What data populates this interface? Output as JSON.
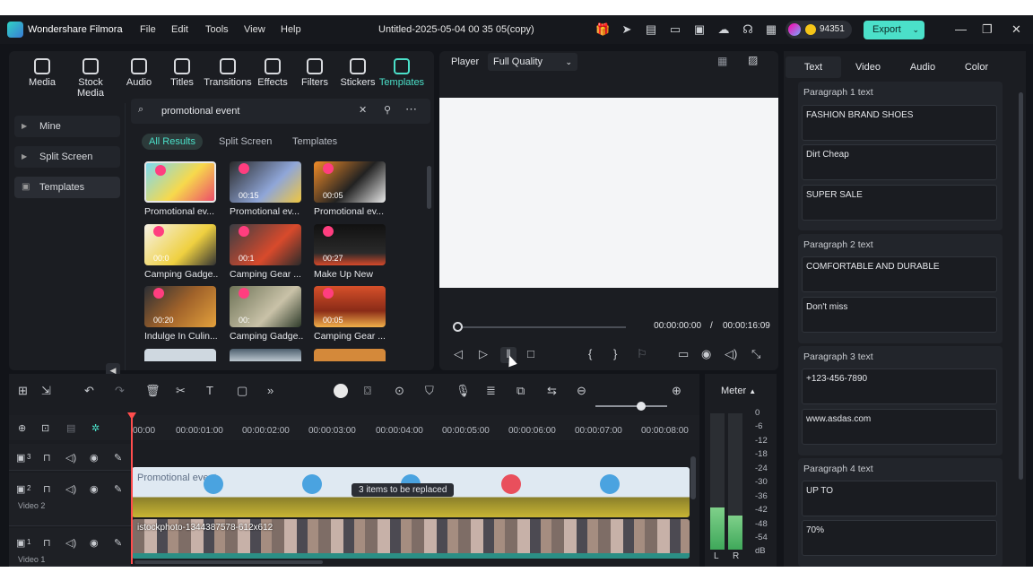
{
  "titlebar": {
    "app_name": "Wondershare Filmora",
    "menus": [
      "File",
      "Edit",
      "Tools",
      "View",
      "Help"
    ],
    "project_title": "Untitled-2025-05-04 00 35 05(copy)",
    "coins": "94351",
    "export_label": "Export"
  },
  "library": {
    "tools": [
      {
        "label": "Media",
        "icon": "media-icon"
      },
      {
        "label": "Stock Media",
        "icon": "stock-media-icon"
      },
      {
        "label": "Audio",
        "icon": "audio-icon"
      },
      {
        "label": "Titles",
        "icon": "titles-icon"
      },
      {
        "label": "Transitions",
        "icon": "transitions-icon"
      },
      {
        "label": "Effects",
        "icon": "effects-icon"
      },
      {
        "label": "Filters",
        "icon": "filters-icon"
      },
      {
        "label": "Stickers",
        "icon": "stickers-icon"
      },
      {
        "label": "Templates",
        "icon": "templates-icon"
      }
    ],
    "active_tool": "Templates",
    "side_items": [
      "Mine",
      "Split Screen",
      "Templates"
    ],
    "search_value": "promotional event",
    "filters": [
      "All Results",
      "Split Screen",
      "Templates"
    ],
    "cards": [
      {
        "title": "Promotional ev...",
        "duration": ""
      },
      {
        "title": "Promotional ev...",
        "duration": "00:15"
      },
      {
        "title": "Promotional ev...",
        "duration": "00:05"
      },
      {
        "title": "Camping Gadge...",
        "duration": "00:0"
      },
      {
        "title": "Camping Gear ...",
        "duration": "00:1"
      },
      {
        "title": "Make Up New",
        "duration": "00:27"
      },
      {
        "title": "Indulge In Culin...",
        "duration": "00:20"
      },
      {
        "title": "Camping Gadge...",
        "duration": "00:"
      },
      {
        "title": "Camping Gear ...",
        "duration": "00:05"
      }
    ]
  },
  "player": {
    "label": "Player",
    "quality": "Full Quality",
    "current_time": "00:00:00:00",
    "separator": "/",
    "total_time": "00:00:16:09"
  },
  "properties": {
    "tabs": [
      "Text",
      "Video",
      "Audio",
      "Color"
    ],
    "active_tab": "Text",
    "paragraphs": [
      {
        "title": "Paragraph 1 text",
        "fields": [
          "FASHION BRAND SHOES",
          "Dirt Cheap",
          "SUPER SALE"
        ]
      },
      {
        "title": "Paragraph 2 text",
        "fields": [
          "COMFORTABLE AND DURABLE",
          "Don't miss"
        ]
      },
      {
        "title": "Paragraph 3 text",
        "fields": [
          "+123-456-7890",
          "www.asdas.com"
        ]
      },
      {
        "title": "Paragraph 4 text",
        "fields": [
          "UP TO",
          "70%"
        ]
      }
    ]
  },
  "timeline": {
    "ruler": [
      "00:00",
      "00:00:01:00",
      "00:00:02:00",
      "00:00:03:00",
      "00:00:04:00",
      "00:00:05:00",
      "00:00:06:00",
      "00:00:07:00",
      "00:00:08:00"
    ],
    "tracks": [
      {
        "index": "3",
        "name": ""
      },
      {
        "index": "2",
        "name": "Video 2"
      },
      {
        "index": "1",
        "name": "Video 1"
      }
    ],
    "clip_video2_label": "Promotional event",
    "clip_video1_label": "istockphoto-1344387578-612x612",
    "replace_tooltip": "3 items to be replaced"
  },
  "meter": {
    "title": "Meter",
    "scale": [
      "0",
      "-6",
      "-12",
      "-18",
      "-24",
      "-30",
      "-36",
      "-42",
      "-48",
      "-54",
      "dB"
    ],
    "channels": [
      "L",
      "R"
    ],
    "levels": [
      0.31,
      0.25
    ],
    "colors": {
      "fill": "#5cc06e",
      "accent": "#4be0c9"
    }
  }
}
